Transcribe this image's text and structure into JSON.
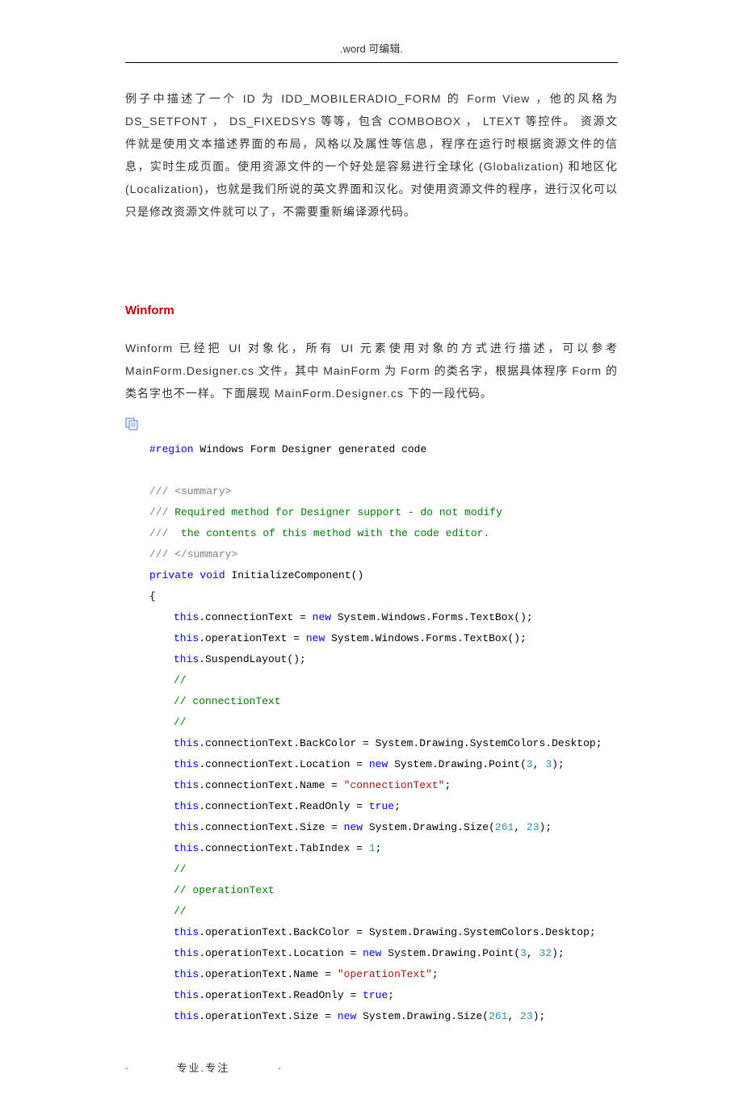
{
  "header": "​.word 可编辑.",
  "paragraphs": {
    "p1": "例子中描述了一个 ID 为 IDD_MOBILERADIO_FORM 的 Form View ，他的风格为 DS_SETFONT ， DS_FIXEDSYS 等等，包含 COMBOBOX ， LTEXT 等控件。 资源文件就是使用文本描述界面的布局，风格以及属性等信息，程序在运行时根据资源文件的信息，实时生成页面。使用资源文件的一个好处是容易进行全球化 (Globalization) 和地区化 (Localization)，也就是我们所说的英文界面和汉化。对使用资源文件的程序，进行汉化可以只是修改资源文件就可以了，不需要重新编译源代码。",
    "h1": "Winform",
    "p2": "Winform 已经把 UI 对象化，所有 UI 元素使用对象的方式进行描述，可以参考 MainForm.Designer.cs 文件，其中 MainForm 为 Form 的类名字，根据具体程序 Form 的类名字也不一样。下面展现 MainForm.Designer.cs  下的一段代码。"
  },
  "code": {
    "l1_kw": "#region",
    "l1_rest": " Windows Form Designer generated code",
    "l2": "/// <summary>",
    "l3_pre": "/// ",
    "l3_txt": "Required method for Designer support - do not modify",
    "l4_pre": "/// ",
    "l4_txt": " the contents of this method with the code editor.",
    "l5": "/// </summary>",
    "l6_private": "private",
    "l6_void": " void",
    "l6_rest": " InitializeComponent()",
    "l7": "{",
    "l8_this": "this",
    "l8_mid": ".connectionText = ",
    "l8_new": "new",
    "l8_end": " System.Windows.Forms.TextBox();",
    "l9_this": "this",
    "l9_mid": ".operationText = ",
    "l9_new": "new",
    "l9_end": " System.Windows.Forms.TextBox();",
    "l10_this": "this",
    "l10_end": ".SuspendLayout();",
    "l11": "//",
    "l12": "// connectionText",
    "l13": "//",
    "l14_this": "this",
    "l14_end": ".connectionText.BackColor = System.Drawing.SystemColors.Desktop;",
    "l15_this": "this",
    "l15_a": ".connectionText.Location = ",
    "l15_new": "new",
    "l15_b": " System.Drawing.Point(",
    "l15_n1": "3",
    "l15_c": ", ",
    "l15_n2": "3",
    "l15_d": ");",
    "l16_this": "this",
    "l16_a": ".connectionText.Name = ",
    "l16_str": "\"connectionText\"",
    "l16_b": ";",
    "l17_this": "this",
    "l17_a": ".connectionText.ReadOnly = ",
    "l17_true": "true",
    "l17_b": ";",
    "l18_this": "this",
    "l18_a": ".connectionText.Size = ",
    "l18_new": "new",
    "l18_b": " System.Drawing.Size(",
    "l18_n1": "261",
    "l18_c": ", ",
    "l18_n2": "23",
    "l18_d": ");",
    "l19_this": "this",
    "l19_a": ".connectionText.TabIndex = ",
    "l19_n": "1",
    "l19_b": ";",
    "l20": "//",
    "l21": "// operationText",
    "l22": "//",
    "l23_this": "this",
    "l23_end": ".operationText.BackColor = System.Drawing.SystemColors.Desktop;",
    "l24_this": "this",
    "l24_a": ".operationText.Location = ",
    "l24_new": "new",
    "l24_b": " System.Drawing.Point(",
    "l24_n1": "3",
    "l24_c": ", ",
    "l24_n2": "32",
    "l24_d": ");",
    "l25_this": "this",
    "l25_a": ".operationText.Name = ",
    "l25_str": "\"operationText\"",
    "l25_b": ";",
    "l26_this": "this",
    "l26_a": ".operationText.ReadOnly = ",
    "l26_true": "true",
    "l26_b": ";",
    "l27_this": "this",
    "l27_a": ".operationText.Size = ",
    "l27_new": "new",
    "l27_b": " System.Drawing.Size(",
    "l27_n1": "261",
    "l27_c": ", ",
    "l27_n2": "23",
    "l27_d": ");"
  },
  "footer": {
    "dot1": " .",
    "text": "专业.专注",
    "dot2": "."
  }
}
